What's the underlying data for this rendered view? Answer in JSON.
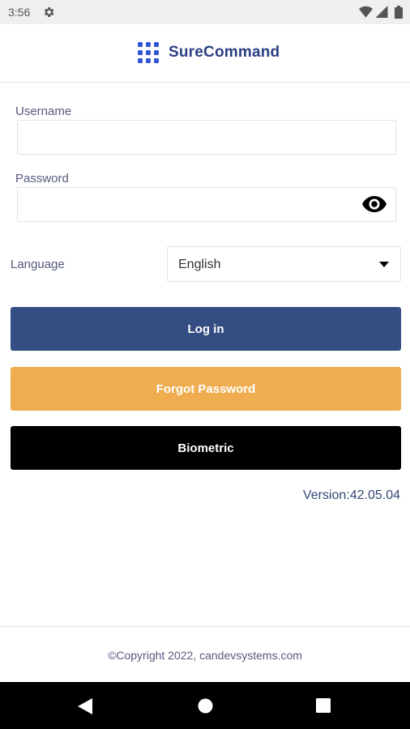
{
  "status_bar": {
    "time": "3:56",
    "icons": [
      "gear-icon",
      "wifi-icon",
      "signal-icon",
      "battery-icon"
    ]
  },
  "header": {
    "app_name": "SureCommand",
    "logo_icon": "grid-dots-icon",
    "accent_color": "#2a3f82"
  },
  "form": {
    "username_label": "Username",
    "username_value": "",
    "password_label": "Password",
    "password_value": "",
    "password_toggle_icon": "eye-icon",
    "language_label": "Language",
    "language_selected": "English"
  },
  "buttons": {
    "login": "Log in",
    "login_color": "#344d83",
    "forgot_password": "Forgot Password",
    "forgot_color": "#efad4f",
    "biometric": "Biometric",
    "biometric_color": "#000000"
  },
  "version": "Version:42.05.04",
  "footer": {
    "copyright": "©Copyright 2022, candevsystems.com"
  },
  "nav_bar": {
    "icons": [
      "back-icon",
      "home-icon",
      "recents-icon"
    ]
  }
}
